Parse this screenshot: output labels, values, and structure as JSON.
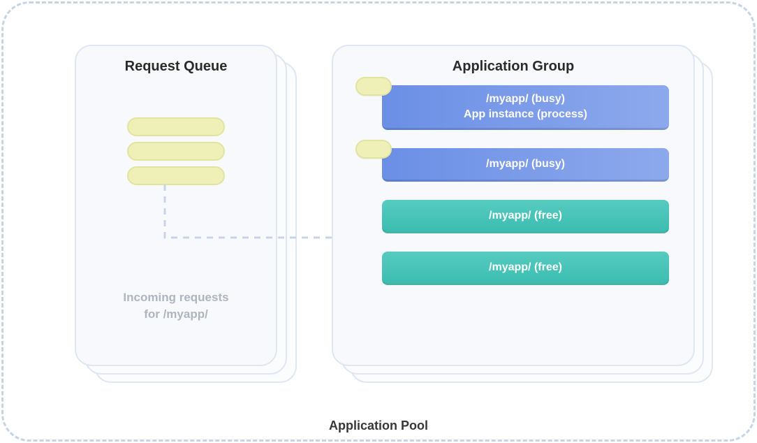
{
  "pool": {
    "label": "Application Pool"
  },
  "queue": {
    "title": "Request Queue",
    "caption_line1": "Incoming requests",
    "caption_line2": "for /myapp/"
  },
  "group": {
    "title": "Application Group",
    "instances": [
      {
        "status": "busy",
        "line1": "/myapp/ (busy)",
        "line2": "App instance (process)",
        "has_request": true
      },
      {
        "status": "busy",
        "line1": "/myapp/ (busy)",
        "line2": "",
        "has_request": true
      },
      {
        "status": "free",
        "line1": "/myapp/ (free)",
        "line2": "",
        "has_request": false
      },
      {
        "status": "free",
        "line1": "/myapp/ (free)",
        "line2": "",
        "has_request": false
      }
    ]
  }
}
